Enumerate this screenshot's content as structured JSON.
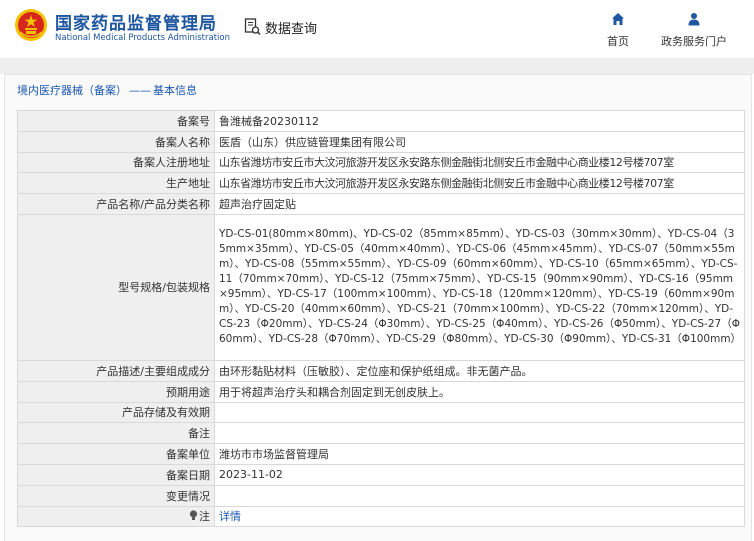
{
  "header": {
    "site_name_cn": "国家药品监督管理局",
    "site_name_en": "National Medical Products Administration",
    "query_label": "数据查询",
    "nav": [
      {
        "label": "首页",
        "icon": "home-icon"
      },
      {
        "label": "政务服务门户",
        "icon": "user-icon"
      }
    ]
  },
  "breadcrumb": {
    "part1": "境内医疗器械（备案）",
    "separator": "——",
    "part2": "基本信息"
  },
  "rows": [
    {
      "key": "备案号",
      "value": "鲁潍械备20230112"
    },
    {
      "key": "备案人名称",
      "value": "医盾（山东）供应链管理集团有限公司"
    },
    {
      "key": "备案人注册地址",
      "value": "山东省潍坊市安丘市大汶河旅游开发区永安路东侧金融街北侧安丘市金融中心商业楼12号楼707室"
    },
    {
      "key": "生产地址",
      "value": "山东省潍坊市安丘市大汶河旅游开发区永安路东侧金融街北侧安丘市金融中心商业楼12号楼707室"
    },
    {
      "key": "产品名称/产品分类名称",
      "value": "超声治疗固定贴"
    },
    {
      "key": "型号规格/包装规格",
      "value": "YD-CS-01(80mm×80mm)、YD-CS-02（85mm×85mm）、YD-CS-03（30mm×30mm）、YD-CS-04（35mm×35mm）、YD-CS-05（40mm×40mm）、YD-CS-06（45mm×45mm）、YD-CS-07（50mm×55mm）、YD-CS-08（55mm×55mm）、YD-CS-09（60mm×60mm）、YD-CS-10（65mm×65mm）、YD-CS-11（70mm×70mm）、YD-CS-12（75mm×75mm）、YD-CS-15（90mm×90mm）、YD-CS-16（95mm×95mm）、YD-CS-17（100mm×100mm）、YD-CS-18（120mm×120mm）、YD-CS-19（60mm×90mm）、YD-CS-20（40mm×60mm）、YD-CS-21（70mm×100mm）、YD-CS-22（70mm×120mm）、YD-CS-23（Φ20mm）、YD-CS-24（Φ30mm）、YD-CS-25（Φ40mm）、YD-CS-26（Φ50mm）、YD-CS-27（Φ60mm）、YD-CS-28（Φ70mm）、YD-CS-29（Φ80mm）、YD-CS-30（Φ90mm）、YD-CS-31（Φ100mm）"
    },
    {
      "key": "产品描述/主要组成成分",
      "value": "由环形黏贴材料（压敏胶）、定位座和保护纸组成。非无菌产品。"
    },
    {
      "key": "预期用途",
      "value": "用于将超声治疗头和耦合剂固定到无创皮肤上。"
    },
    {
      "key": "产品存储及有效期",
      "value": ""
    },
    {
      "key": "备注",
      "value": ""
    },
    {
      "key": "备案单位",
      "value": "潍坊市市场监督管理局"
    },
    {
      "key": "备案日期",
      "value": "2023-11-02"
    },
    {
      "key": "变更情况",
      "value": ""
    },
    {
      "key": "注",
      "value": "详情",
      "icon": "lightbulb-icon"
    }
  ],
  "colors": {
    "brand_blue": "#1e56a0",
    "emblem_red": "#d7261e",
    "emblem_gold": "#f2c200",
    "link_blue": "#1a58b0"
  }
}
